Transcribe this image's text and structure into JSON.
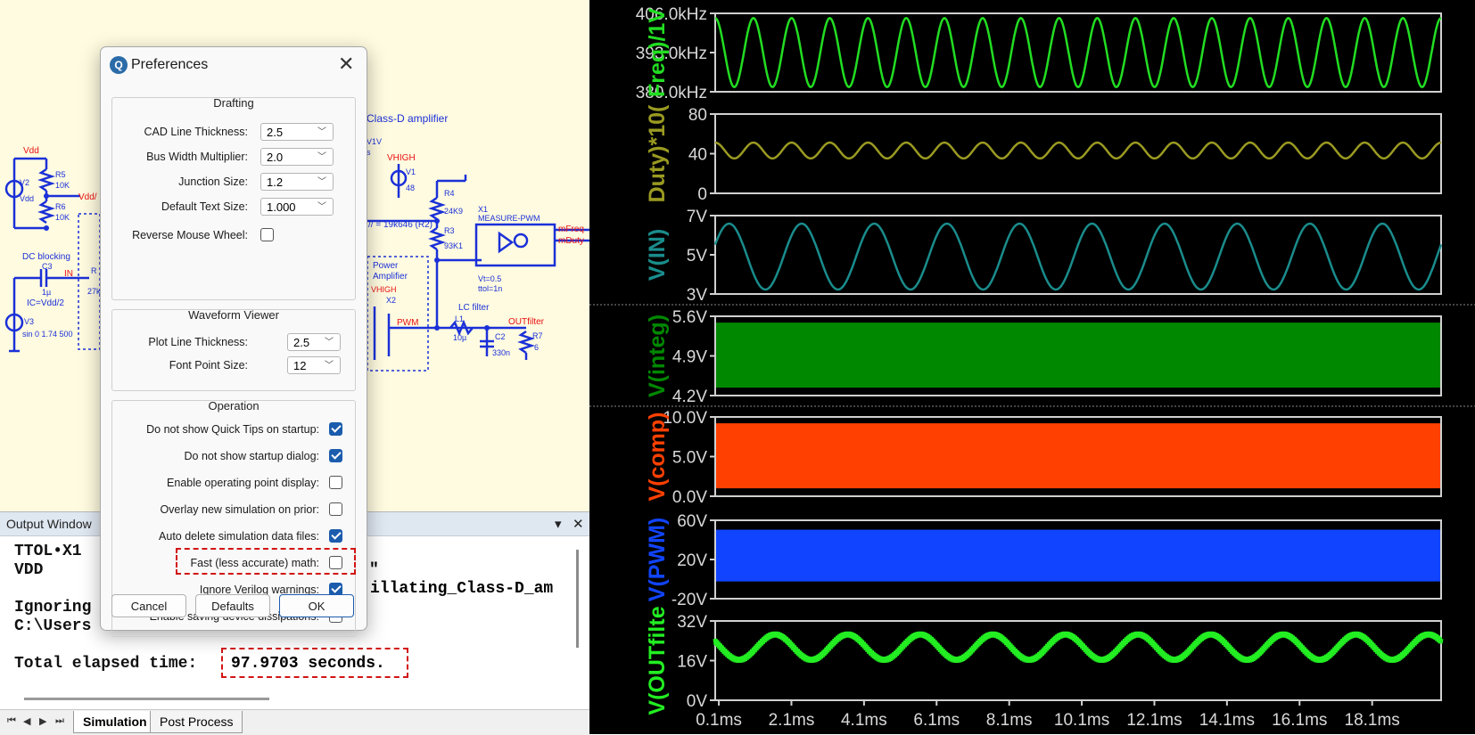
{
  "dialog": {
    "title": "Preferences",
    "app_icon": "ltspice-icon",
    "drafting": {
      "title": "Drafting",
      "cad_line_thickness": {
        "label": "CAD Line Thickness:",
        "value": "2.5"
      },
      "bus_width_multiplier": {
        "label": "Bus Width Multiplier:",
        "value": "2.0"
      },
      "junction_size": {
        "label": "Junction Size:",
        "value": "1.2"
      },
      "default_text_size": {
        "label": "Default Text Size:",
        "value": "1.000"
      },
      "reverse_mouse_wheel": {
        "label": "Reverse Mouse Wheel:",
        "checked": false
      }
    },
    "waveform_viewer": {
      "title": "Waveform Viewer",
      "plot_line_thickness": {
        "label": "Plot Line Thickness:",
        "value": "2.5"
      },
      "font_point_size": {
        "label": "Font Point Size:",
        "value": "12"
      }
    },
    "operation": {
      "title": "Operation",
      "items": [
        {
          "label": "Do not show Quick Tips on startup:",
          "checked": true
        },
        {
          "label": "Do not show startup dialog:",
          "checked": true
        },
        {
          "label": "Enable operating point display:",
          "checked": false
        },
        {
          "label": "Overlay new simulation on prior:",
          "checked": false
        },
        {
          "label": "Auto delete simulation data files:",
          "checked": true
        },
        {
          "label": "Fast (less accurate) math:",
          "checked": false,
          "highlighted": true
        },
        {
          "label": "Ignore Verilog warnings:",
          "checked": true
        },
        {
          "label": "Enable saving device dissipations:",
          "checked": false
        }
      ]
    },
    "buttons": {
      "cancel": "Cancel",
      "defaults": "Defaults",
      "ok": "OK"
    }
  },
  "output_window": {
    "title": "Output Window",
    "lines": [
      "TTOL•X1",
      "VDD",
      "",
      "Ignoring",
      "C:\\Users",
      "",
      "Total elapsed time:"
    ],
    "fragment_quote": "\"",
    "fragment_path": "illating_Class-D_am",
    "elapsed_value": "97.9703 seconds."
  },
  "tabs": {
    "items": [
      "Simulation",
      "Post Process"
    ],
    "active": "Simulation",
    "nav_icons": [
      "first-icon",
      "prev-icon",
      "next-icon",
      "last-icon"
    ]
  },
  "schematic": {
    "labels": {
      "vdd1": "Vdd",
      "v2": "V2",
      "v2val": "Vdd",
      "r5": "R5",
      "r5val": "10K",
      "r6": "R6",
      "r6val": "10K",
      "vddnet": "Vdd/",
      "dcblock": "DC blocking",
      "c3": "C3",
      "c3val": "1µ",
      "in": "IN",
      "ic": "IC=Vdd/2",
      "v3": "V3",
      "v3val": "sin 0 1.74 500",
      "title": "Class-D amplifier",
      "vhigh1": "VHIGH",
      "v1": "V1",
      "v1val": "48",
      "r4": "R4",
      "r4val": "24K9",
      "r3": "R3",
      "r3val": "93K1",
      "par": "// = 19k646 (R2)",
      "x1": "X1",
      "measure": "MEASURE-PWM",
      "vt": "Vt=0.5",
      "ttol": "ttol=1n",
      "mfreq": "mFreq",
      "mduty": "mDuty",
      "power": "Power",
      "amplifier": "Amplifier",
      "vhigh2": "VHIGH",
      "x2": "X2",
      "pwm": "PWM",
      "lcfilter": "LC filter",
      "l1": "L1",
      "l1val": "10µ",
      "c2": "C2",
      "c2val": "330n",
      "outfilter": "OUTfilter",
      "r7": "R7",
      "r7val": "6",
      "r_frag": "R",
      "r_frag2": "27k",
      "v1v": "V1V",
      "s": "s"
    }
  },
  "waveforms": {
    "background": "#000000",
    "x_ticks": [
      "0.1ms",
      "2.1ms",
      "4.1ms",
      "6.1ms",
      "8.1ms",
      "10.1ms",
      "12.1ms",
      "14.1ms",
      "16.1ms",
      "18.1ms"
    ],
    "panes": [
      {
        "label": "Freq)/1V",
        "color": "#22dd22",
        "ticks": [
          "406.0kHz",
          "393.0kHz",
          "380.0kHz"
        ]
      },
      {
        "label": "Duty)*10(",
        "color": "#9a9a22",
        "ticks": [
          "80",
          "40",
          "0"
        ]
      },
      {
        "label": "V(IN)",
        "color": "#1a8c8c",
        "ticks": [
          "7V",
          "5V",
          "3V"
        ]
      },
      {
        "label": "V(integ)",
        "color": "#008800",
        "ticks": [
          "5.6V",
          "4.9V",
          "4.2V"
        ]
      },
      {
        "label": "V(comp)",
        "color": "#ff4000",
        "ticks": [
          "10.0V",
          "5.0V",
          "0.0V"
        ]
      },
      {
        "label": "V(PWM)",
        "color": "#1144ff",
        "ticks": [
          "60V",
          "20V",
          "-20V"
        ]
      },
      {
        "label": "V(OUTfilte",
        "color": "#22ee22",
        "ticks": [
          "32V",
          "16V",
          "0V"
        ]
      }
    ]
  }
}
